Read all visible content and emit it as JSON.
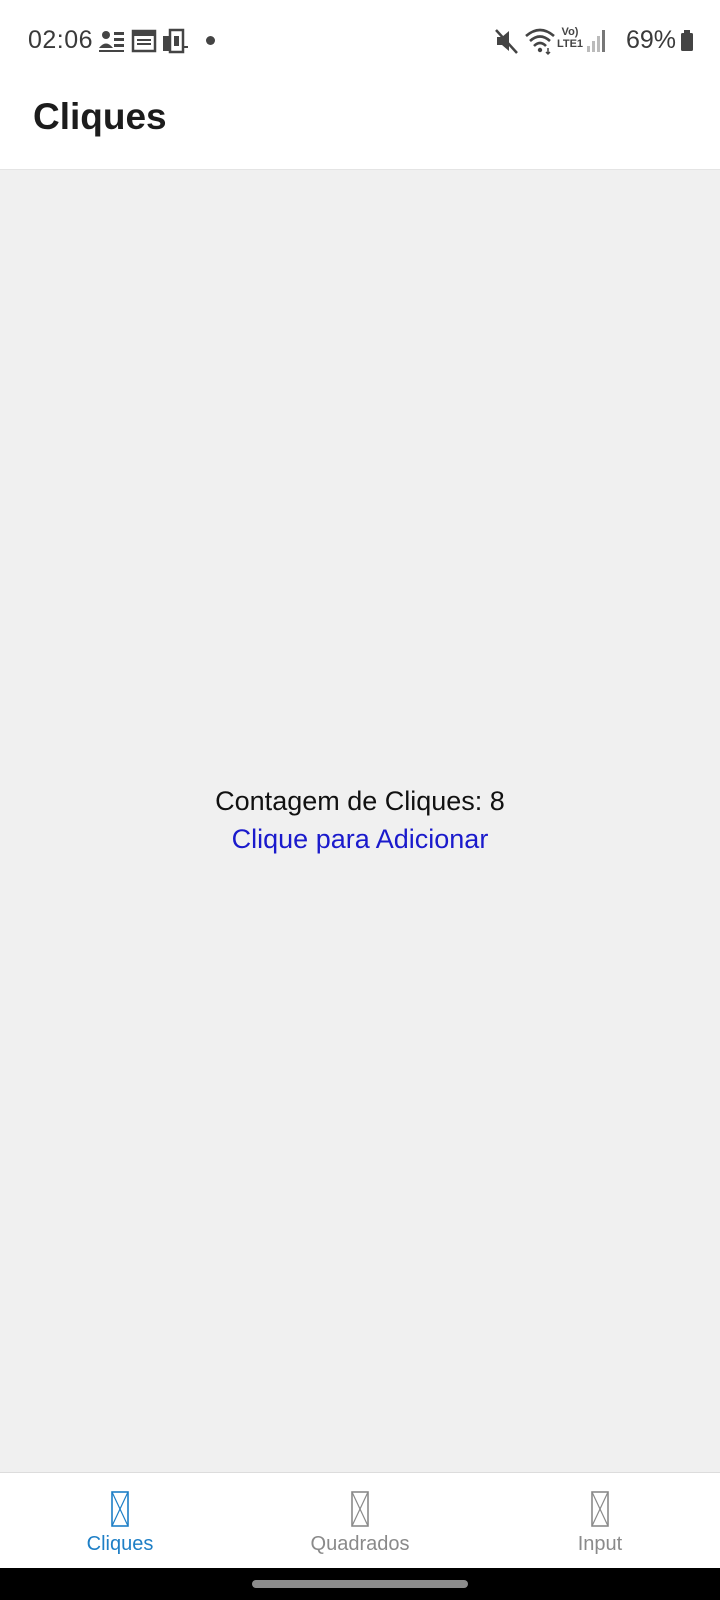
{
  "status_bar": {
    "time": "02:06",
    "battery_percent": "69%",
    "network_label_top": "Vo)",
    "network_label_bottom": "LTE1",
    "notification_icons": [
      "contacts-icon",
      "calendar-icon",
      "device-icon"
    ],
    "status_icons": [
      "mute-icon",
      "wifi-icon",
      "volte-icon",
      "signal-icon",
      "battery-icon"
    ]
  },
  "app_bar": {
    "title": "Cliques"
  },
  "main": {
    "counter_label": "Contagem de Cliques: 8",
    "add_link_label": "Clique para Adicionar"
  },
  "tabs": [
    {
      "label": "Cliques",
      "active": true
    },
    {
      "label": "Quadrados",
      "active": false
    },
    {
      "label": "Input",
      "active": false
    }
  ],
  "colors": {
    "active_tab": "#1e7fc6",
    "inactive_tab": "#8a8a8a",
    "link": "#1a1acc",
    "content_background": "#f0f0f0"
  }
}
